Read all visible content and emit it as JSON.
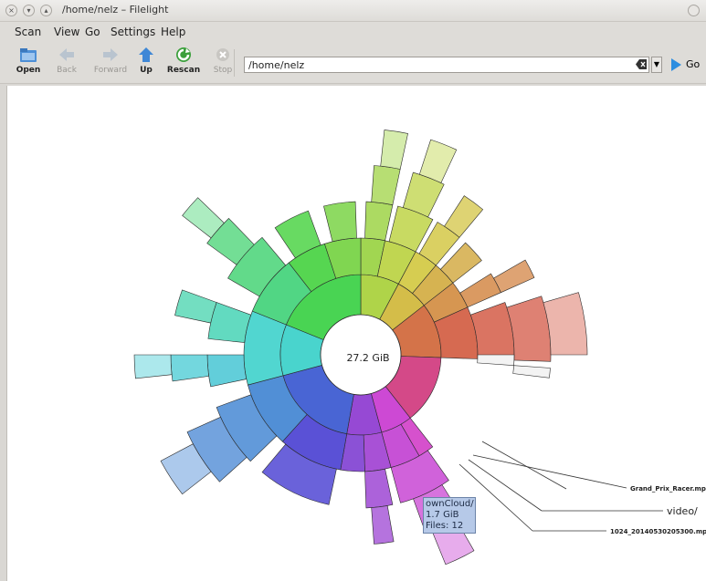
{
  "window": {
    "title": "/home/nelz – Filelight"
  },
  "menu": [
    "Scan",
    "View",
    "Go",
    "Settings",
    "Help"
  ],
  "toolbar": {
    "open": "Open",
    "back": "Back",
    "forward": "Forward",
    "up": "Up",
    "rescan": "Rescan",
    "stop": "Stop",
    "address_value": "/home/nelz",
    "go": "Go"
  },
  "colors": {
    "tooltip_bg": "#b6c9e8",
    "accent": "#2d8ee0"
  },
  "map": {
    "total_size": "27.2 GiB",
    "tooltip": {
      "name": "ownCloud/",
      "size": "1.7 GiB",
      "files": "Files: 12"
    },
    "labels": {
      "grand_prix": "Grand_Prix_Racer.mpg",
      "video": "video/",
      "clip": "1024_20140530205300.mpg"
    }
  }
}
